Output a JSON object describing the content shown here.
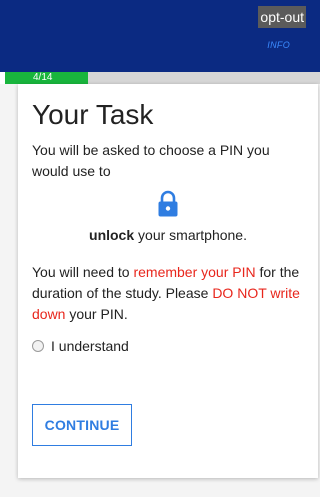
{
  "header": {
    "optout_label": "opt-out",
    "info_label": "INFO"
  },
  "progress": {
    "label": "4/14",
    "current": 4,
    "total": 14
  },
  "card": {
    "title": "Your Task",
    "intro": "You will be asked to choose a PIN you would use to",
    "lock_icon": "lock-icon",
    "unlock_bold": "unlock",
    "unlock_rest": " your smartphone.",
    "p2_part1": "You will need to ",
    "p2_red1": "remember your PIN",
    "p2_part2": " for the duration of the study. Please ",
    "p2_red2": "DO NOT write down",
    "p2_part3": " your PIN.",
    "radio_label": "I understand",
    "continue_label": "CONTINUE"
  },
  "colors": {
    "header_bg": "#0b2a82",
    "progress_fill": "#19b53d",
    "accent_blue": "#2f7de1",
    "warning_red": "#e8261c"
  }
}
